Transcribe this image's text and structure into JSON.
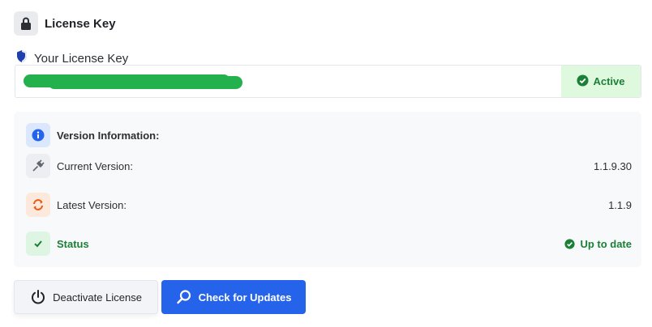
{
  "header": {
    "title": "License Key",
    "icon": "lock-icon"
  },
  "license": {
    "label": "Your License Key",
    "label_icon": "shield-icon",
    "key_value": "",
    "status": "Active",
    "status_color": "#1a7f37",
    "status_bg": "#dff9de"
  },
  "version_info": {
    "title": "Version Information:",
    "rows": [
      {
        "label": "Current Version:",
        "value": "1.1.9.30",
        "icon": "plug-icon"
      },
      {
        "label": "Latest Version:",
        "value": "1.1.9",
        "icon": "refresh-icon"
      },
      {
        "label": "Status",
        "value": "Up to date",
        "icon": "check-icon"
      }
    ]
  },
  "buttons": {
    "deactivate": "Deactivate License",
    "check_updates": "Check for Updates"
  },
  "colors": {
    "accent": "#2563eb",
    "success": "#1a7f37",
    "warning_orange": "#e8590c"
  }
}
